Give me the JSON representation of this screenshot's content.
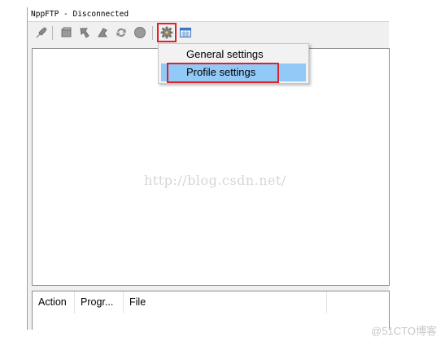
{
  "window": {
    "title": "NppFTP - Disconnected"
  },
  "toolbar": {
    "icons": [
      "connect-icon",
      "refresh-icon",
      "download-icon",
      "upload-icon",
      "sync-icon",
      "abort-icon",
      "settings-icon",
      "message-window-icon"
    ],
    "highlight_color": "#e0202a"
  },
  "settings_menu": {
    "items": [
      {
        "label": "General settings",
        "selected": false
      },
      {
        "label": "Profile settings",
        "selected": true
      }
    ],
    "selected_color": "#91c9f7"
  },
  "transfer_queue": {
    "columns": [
      "Action",
      "Progr...",
      "File"
    ]
  },
  "watermarks": {
    "center": "http://blog.csdn.net/",
    "corner": "@51CTO博客"
  }
}
